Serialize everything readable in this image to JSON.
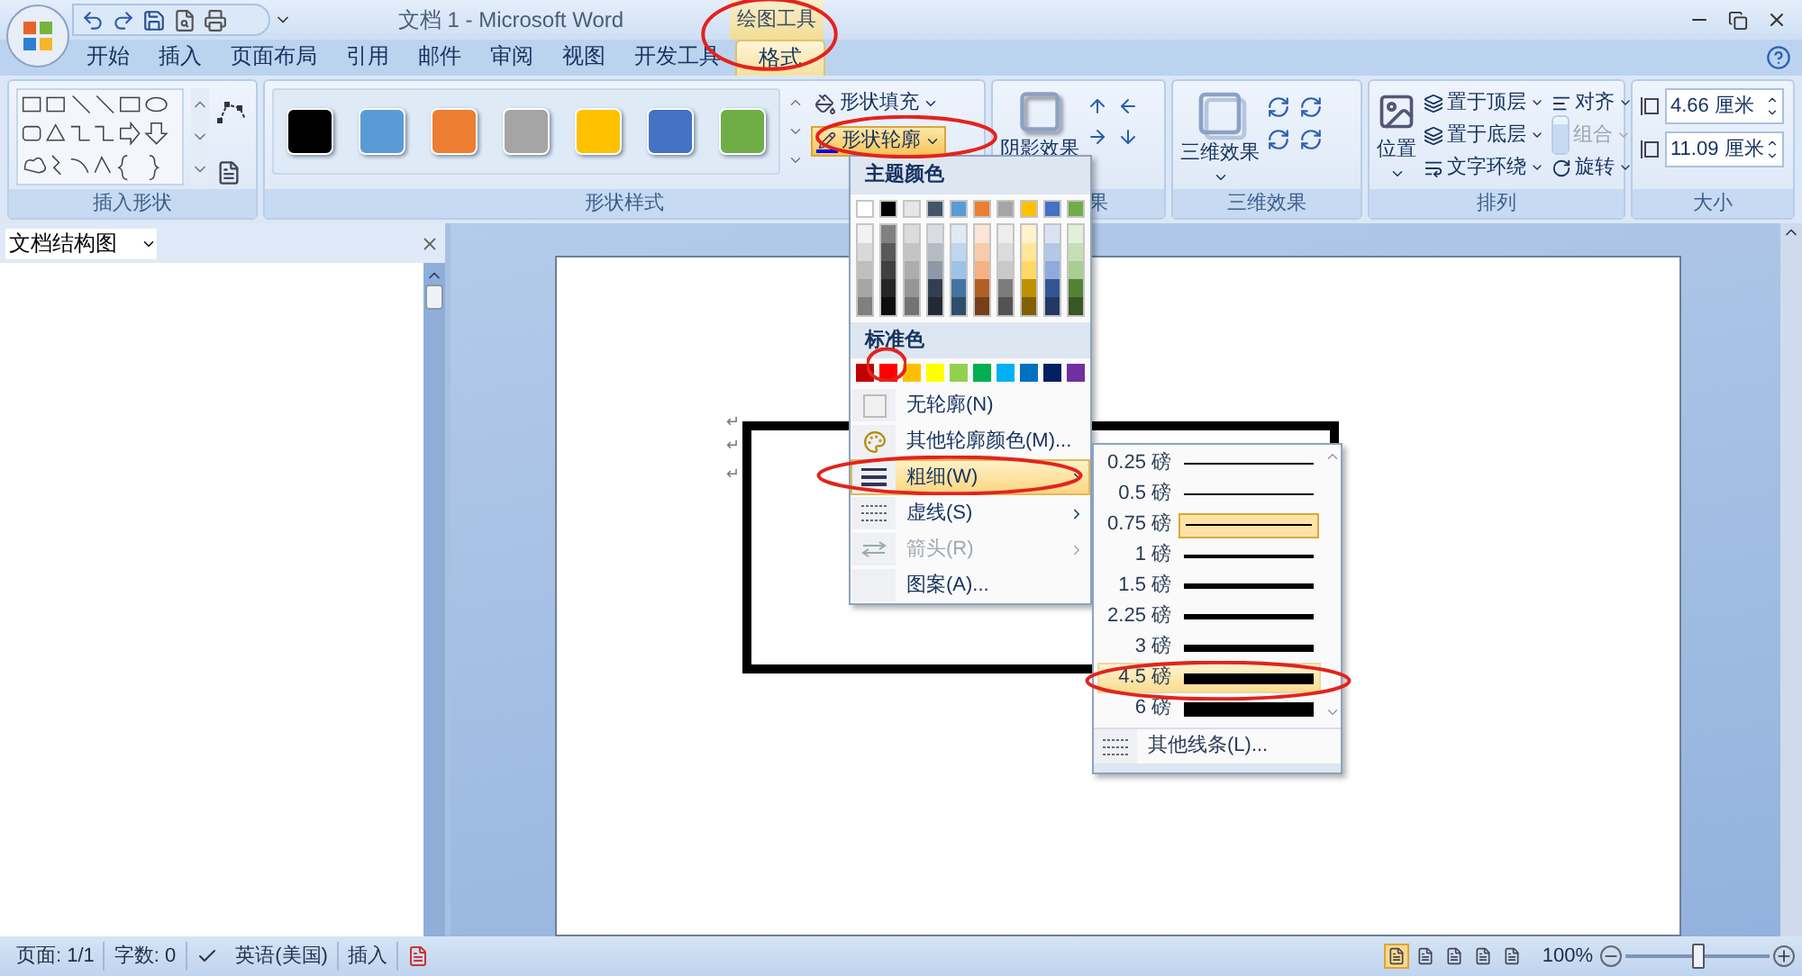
{
  "title_bar": {
    "title": "文档 1 - Microsoft Word",
    "context_label": "绘图工具"
  },
  "tabs": [
    {
      "label": "开始",
      "selected": false
    },
    {
      "label": "插入",
      "selected": false
    },
    {
      "label": "页面布局",
      "selected": false
    },
    {
      "label": "引用",
      "selected": false
    },
    {
      "label": "邮件",
      "selected": false
    },
    {
      "label": "审阅",
      "selected": false
    },
    {
      "label": "视图",
      "selected": false
    },
    {
      "label": "开发工具",
      "selected": false
    },
    {
      "label": "格式",
      "selected": true
    }
  ],
  "insert_shapes": {
    "label": "插入形状"
  },
  "shape_styles": {
    "label": "形状样式",
    "swatches": [
      {
        "color": "#000000"
      },
      {
        "color": "#5b9bd5"
      },
      {
        "color": "#ed7d31"
      },
      {
        "color": "#a5a5a5"
      },
      {
        "color": "#ffc000"
      },
      {
        "color": "#4472c4"
      },
      {
        "color": "#70ad47"
      }
    ],
    "fill_button": {
      "label": "形状填充",
      "highlighted": false
    },
    "outline_button": {
      "label": "形状轮廓",
      "highlighted": true
    }
  },
  "shadow": {
    "button": "阴影效果",
    "label": "果"
  },
  "three_d": {
    "button": "三维效果",
    "label": "三维效果"
  },
  "arrange": {
    "position": "位置",
    "label": "排列",
    "items": [
      {
        "label": "置于顶层",
        "disabled": false
      },
      {
        "label": "置于底层",
        "disabled": false
      },
      {
        "label": "文字环绕",
        "disabled": false
      },
      {
        "label": "对齐",
        "disabled": false
      },
      {
        "label": "组合",
        "disabled": true
      },
      {
        "label": "旋转",
        "disabled": false
      }
    ]
  },
  "size": {
    "label": "大小",
    "fields": [
      {
        "value": "4.66 厘米"
      },
      {
        "value": "11.09 厘米"
      }
    ]
  },
  "nav_pane": {
    "title": "文档结构图"
  },
  "document": {
    "paragraph_marks": [
      "↵",
      "↵",
      "↵"
    ]
  },
  "status_bar": {
    "items": [
      {
        "label": "页面: 1/1"
      },
      {
        "label": "字数: 0"
      },
      {
        "label": "英语(美国)"
      },
      {
        "label": "插入"
      }
    ],
    "zoom": "100%",
    "zoom_slider": {
      "level": 0.5
    }
  },
  "outline_menu": {
    "theme_header": "主题颜色",
    "standard_header": "标准色",
    "theme_colors": [
      {
        "color": "#ffffff"
      },
      {
        "color": "#000000"
      },
      {
        "color": "#e7e6e6"
      },
      {
        "color": "#44546a"
      },
      {
        "color": "#5b9bd5"
      },
      {
        "color": "#ed7d31"
      },
      {
        "color": "#a5a5a5"
      },
      {
        "color": "#ffc000"
      },
      {
        "color": "#4472c4"
      },
      {
        "color": "#70ad47"
      }
    ],
    "standard_colors": [
      {
        "color": "#c00000"
      },
      {
        "color": "#ff0000"
      },
      {
        "color": "#ffc000"
      },
      {
        "color": "#ffff00"
      },
      {
        "color": "#92d050"
      },
      {
        "color": "#00b050"
      },
      {
        "color": "#00b0f0"
      },
      {
        "color": "#0070c0"
      },
      {
        "color": "#002060"
      },
      {
        "color": "#7030a0"
      }
    ],
    "items": [
      {
        "kind": "no-outline",
        "label": "无轮廓(N)",
        "submenu": false,
        "highlighted": false,
        "disabled": false
      },
      {
        "kind": "more-colors",
        "label": "其他轮廓颜色(M)...",
        "submenu": false,
        "highlighted": false,
        "disabled": false
      },
      {
        "kind": "weight",
        "label": "粗细(W)",
        "submenu": true,
        "highlighted": true,
        "disabled": false
      },
      {
        "kind": "dashes",
        "label": "虚线(S)",
        "submenu": true,
        "highlighted": false,
        "disabled": false
      },
      {
        "kind": "arrows",
        "label": "箭头(R)",
        "submenu": true,
        "highlighted": false,
        "disabled": true
      },
      {
        "kind": "pattern",
        "label": "图案(A)...",
        "submenu": false,
        "highlighted": false,
        "disabled": false
      }
    ]
  },
  "weight_menu": {
    "items": [
      {
        "label": "0.25 磅",
        "selected": false,
        "highlighted": false
      },
      {
        "label": "0.5 磅",
        "selected": false,
        "highlighted": false
      },
      {
        "label": "0.75 磅",
        "selected": true,
        "highlighted": false
      },
      {
        "label": "1 磅",
        "selected": false,
        "highlighted": false
      },
      {
        "label": "1.5 磅",
        "selected": false,
        "highlighted": false
      },
      {
        "label": "2.25 磅",
        "selected": false,
        "highlighted": false
      },
      {
        "label": "3 磅",
        "selected": false,
        "highlighted": false
      },
      {
        "label": "4.5 磅",
        "selected": false,
        "highlighted": true
      },
      {
        "label": "6 磅",
        "selected": false,
        "highlighted": false
      }
    ],
    "footer": "其他线条(L)..."
  }
}
